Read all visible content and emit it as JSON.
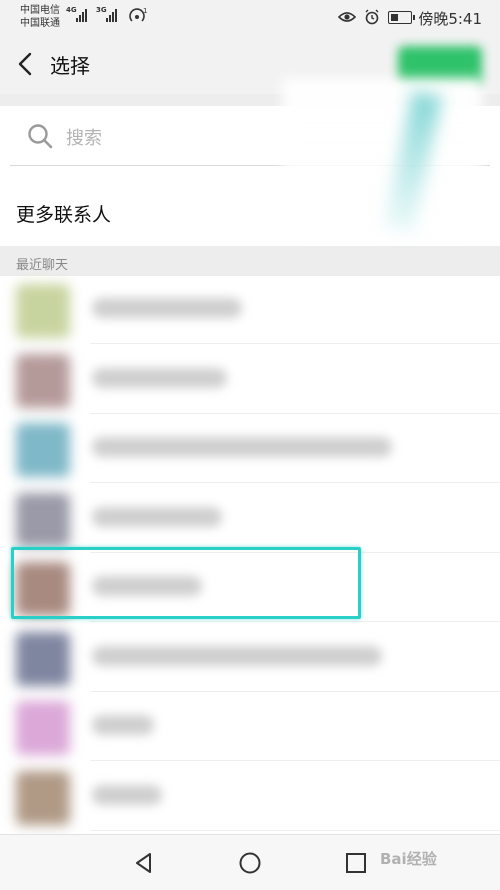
{
  "status_bar": {
    "carrier_1": "中国电信",
    "carrier_2": "中国联通",
    "net_1": "4G",
    "net_2": "3G",
    "time": "傍晚5:41"
  },
  "nav": {
    "title": "选择"
  },
  "search": {
    "placeholder": "搜索"
  },
  "more_contacts": {
    "label": "更多联系人"
  },
  "recent_section": {
    "label": "最近聊天"
  },
  "chats": [
    {
      "name": "",
      "avatar_color": "#c8d4a0",
      "name_width": 150,
      "selected": false
    },
    {
      "name": "",
      "avatar_color": "#b59a9a",
      "name_width": 135,
      "selected": false
    },
    {
      "name": "",
      "avatar_color": "#7fb8c8",
      "name_width": 300,
      "selected": false
    },
    {
      "name": "",
      "avatar_color": "#9a9aa8",
      "name_width": 130,
      "selected": false
    },
    {
      "name": "",
      "avatar_color": "#a88a80",
      "name_width": 110,
      "selected": true
    },
    {
      "name": "",
      "avatar_color": "#7f86a0",
      "name_width": 290,
      "selected": false
    },
    {
      "name": "",
      "avatar_color": "#dba8d8",
      "name_width": 62,
      "selected": false
    },
    {
      "name": "",
      "avatar_color": "#b09a86",
      "name_width": 70,
      "selected": false
    }
  ],
  "watermark": "Bai经验",
  "colors": {
    "accent_green": "#2ec26a",
    "highlight_teal": "#2ad0c8"
  }
}
